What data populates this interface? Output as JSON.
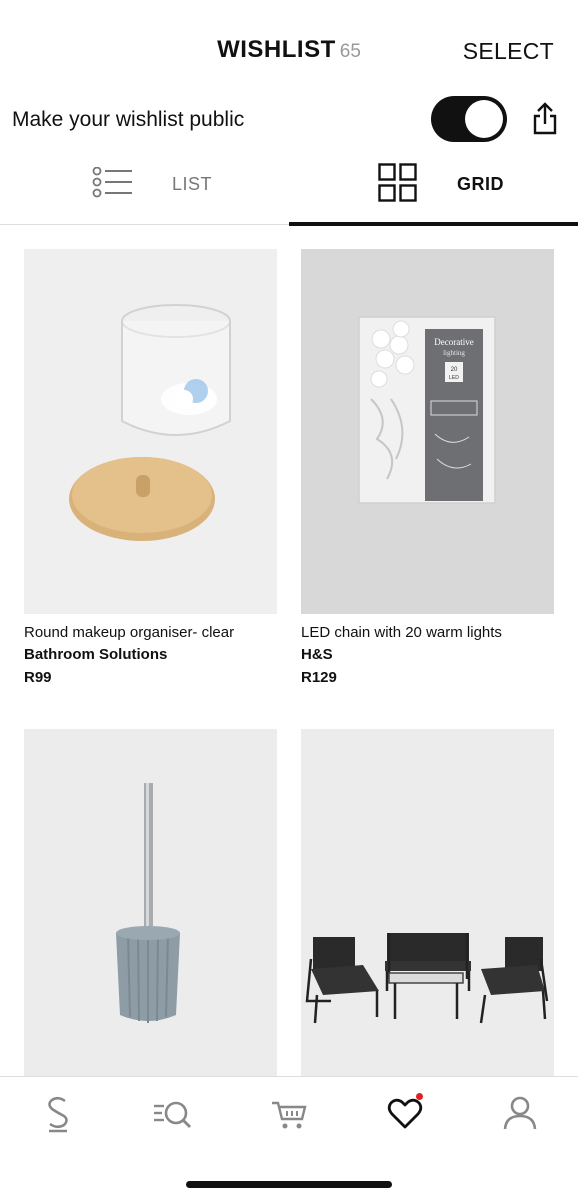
{
  "header": {
    "title": "WISHLIST",
    "count": "65",
    "select_label": "SELECT"
  },
  "public_toggle": {
    "label": "Make your wishlist public",
    "enabled": true
  },
  "tabs": [
    {
      "label": "LIST",
      "active": false
    },
    {
      "label": "GRID",
      "active": true
    }
  ],
  "products": [
    {
      "name": "Round makeup organiser- clear",
      "brand": "Bathroom Solutions",
      "price": "R99"
    },
    {
      "name": "LED chain with 20 warm lights",
      "brand": "H&S",
      "price": "R129"
    },
    {
      "name": "",
      "brand": "",
      "price": ""
    },
    {
      "name": "",
      "brand": "",
      "price": ""
    }
  ],
  "packaging": {
    "title": "Decorative",
    "subtitle": "lighting",
    "badge": "20",
    "badge_sub": "LED"
  },
  "bottom_nav": [
    {
      "icon": "home-s-icon"
    },
    {
      "icon": "search-icon"
    },
    {
      "icon": "cart-icon"
    },
    {
      "icon": "heart-icon",
      "active": true,
      "has_badge": true
    },
    {
      "icon": "account-icon"
    }
  ],
  "colors": {
    "accent": "#111111",
    "badge": "#e02020",
    "image_bg": "#ececec"
  }
}
